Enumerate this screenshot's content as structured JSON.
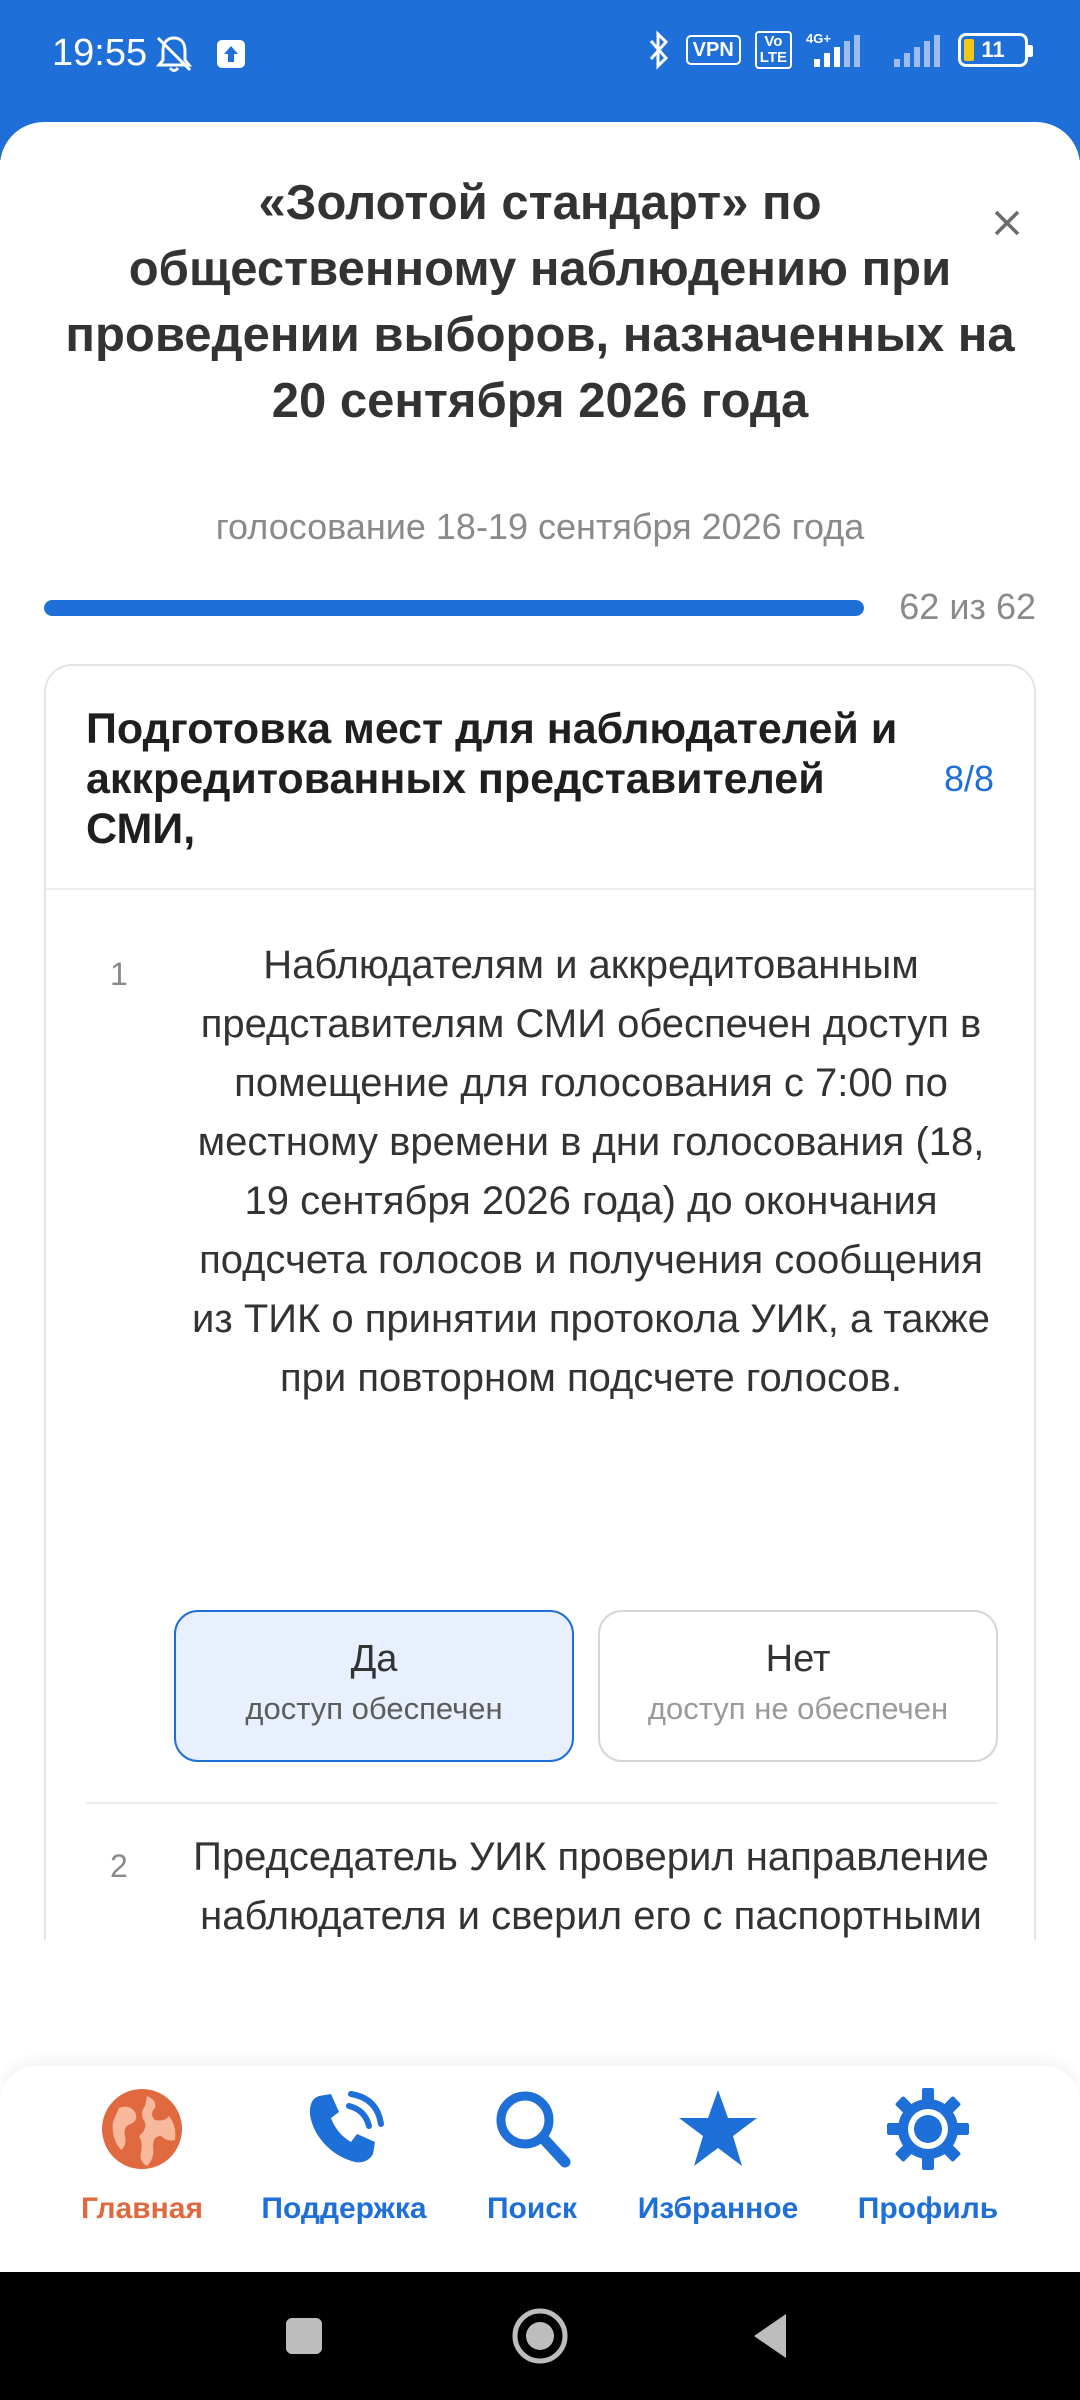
{
  "status_bar": {
    "time": "19:55",
    "vpn": "VPN",
    "volte": "Vo\nLTE",
    "network": "4G+",
    "battery": "11"
  },
  "sheet": {
    "title": "«Золотой стандарт» по общественному наблюдению при проведении выборов, назначенных на 20 сентября 2026 года",
    "subtitle": "голосование 18-19 сентября 2026 года",
    "progress": {
      "label": "62 из 62",
      "fraction": 1.0
    }
  },
  "section": {
    "title": "Подготовка мест для наблюдателей и аккредитованных представителей СМИ,",
    "count": "8/8",
    "questions": [
      {
        "number": "1",
        "text": "Наблюдателям и аккредитованным представителям СМИ обеспечен доступ в помещение для голосования с 7:00 по местному времени в дни голосования (18, 19 сентября 2026 года) до окончания подсчета голосов и получения сообщения из ТИК о принятии протокола УИК, а также при повторном подсчете голосов.",
        "yes": {
          "title": "Да",
          "subtitle": "доступ обеспечен"
        },
        "no": {
          "title": "Нет",
          "subtitle": "доступ не обеспечен"
        }
      },
      {
        "number": "2",
        "text": "Председатель УИК проверил направление наблюдателя и сверил его с паспортными данными, а также удостоверился, что наблюдатель"
      }
    ]
  },
  "bottom_nav": {
    "items": [
      {
        "label": "Главная",
        "icon": "globe-icon",
        "active": true
      },
      {
        "label": "Поддержка",
        "icon": "phone-icon"
      },
      {
        "label": "Поиск",
        "icon": "search-icon"
      },
      {
        "label": "Избранное",
        "icon": "star-icon"
      },
      {
        "label": "Профиль",
        "icon": "gear-icon"
      }
    ]
  },
  "colors": {
    "accent": "#1f6fd9",
    "active_nav": "#e0693f",
    "selected_bg": "#e7f0fc"
  }
}
